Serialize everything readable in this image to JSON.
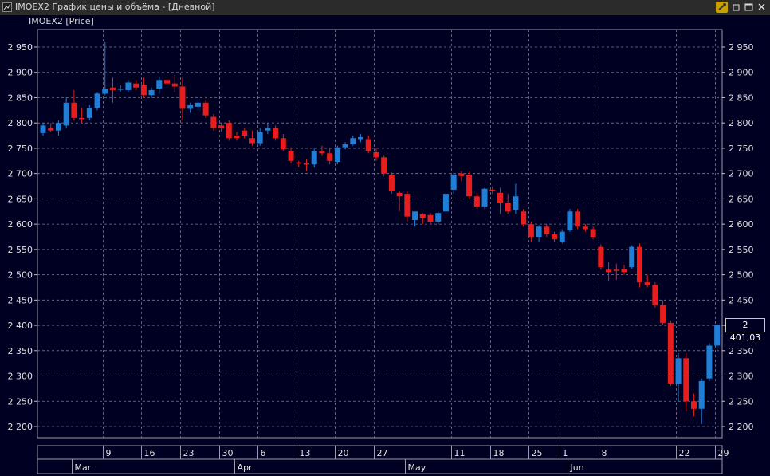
{
  "window": {
    "title": "IMOEX2 График цены и объёма - [Дневной]",
    "buttons": [
      "pin",
      "restore",
      "close"
    ]
  },
  "legend": {
    "label": "IMOEX2 [Price]"
  },
  "last_value_label": "2 401,03",
  "colors": {
    "background": "#000022",
    "up": "#1f7fd6",
    "down": "#e81e1e",
    "grid": "#7a7a90"
  },
  "chart_data": {
    "type": "candlestick",
    "title": "",
    "y_axis": {
      "ylim": [
        2180,
        2970
      ],
      "ticks": [
        2950,
        2900,
        2850,
        2800,
        2750,
        2700,
        2650,
        2600,
        2550,
        2500,
        2450,
        2400,
        2350,
        2300,
        2250,
        2200
      ],
      "tick_labels": [
        "2 950",
        "2 900",
        "2 850",
        "2 800",
        "2 750",
        "2 700",
        "2 650",
        "2 600",
        "2 550",
        "2 500",
        "2 450",
        "2 400",
        "2 350",
        "2 300",
        "2 250",
        "2 200"
      ],
      "both_sides": true
    },
    "x_axis": {
      "day_labels": [
        {
          "label": "9",
          "index": 8
        },
        {
          "label": "16",
          "index": 13
        },
        {
          "label": "23",
          "index": 18
        },
        {
          "label": "30",
          "index": 23
        },
        {
          "label": "6",
          "index": 28
        },
        {
          "label": "13",
          "index": 33
        },
        {
          "label": "20",
          "index": 38
        },
        {
          "label": "27",
          "index": 43
        },
        {
          "label": "11",
          "index": 53
        },
        {
          "label": "18",
          "index": 58
        },
        {
          "label": "25",
          "index": 63
        },
        {
          "label": "1",
          "index": 67
        },
        {
          "label": "8",
          "index": 72
        },
        {
          "label": "22",
          "index": 82
        },
        {
          "label": "29",
          "index": 87
        }
      ],
      "month_labels": [
        {
          "label": "Mar",
          "index": 4
        },
        {
          "label": "Apr",
          "index": 25
        },
        {
          "label": "May",
          "index": 47
        },
        {
          "label": "Jun",
          "index": 68
        }
      ]
    },
    "grid": true,
    "candles": [
      {
        "o": 2780,
        "h": 2800,
        "l": 2775,
        "c": 2795
      },
      {
        "o": 2790,
        "h": 2800,
        "l": 2782,
        "c": 2785
      },
      {
        "o": 2785,
        "h": 2805,
        "l": 2775,
        "c": 2800
      },
      {
        "o": 2795,
        "h": 2850,
        "l": 2790,
        "c": 2840
      },
      {
        "o": 2840,
        "h": 2865,
        "l": 2805,
        "c": 2810
      },
      {
        "o": 2810,
        "h": 2830,
        "l": 2800,
        "c": 2808
      },
      {
        "o": 2810,
        "h": 2835,
        "l": 2805,
        "c": 2830
      },
      {
        "o": 2830,
        "h": 2860,
        "l": 2825,
        "c": 2858
      },
      {
        "o": 2858,
        "h": 2960,
        "l": 2855,
        "c": 2868
      },
      {
        "o": 2870,
        "h": 2890,
        "l": 2840,
        "c": 2865
      },
      {
        "o": 2866,
        "h": 2875,
        "l": 2862,
        "c": 2868
      },
      {
        "o": 2865,
        "h": 2885,
        "l": 2860,
        "c": 2880
      },
      {
        "o": 2878,
        "h": 2885,
        "l": 2865,
        "c": 2870
      },
      {
        "o": 2875,
        "h": 2890,
        "l": 2850,
        "c": 2855
      },
      {
        "o": 2855,
        "h": 2870,
        "l": 2850,
        "c": 2865
      },
      {
        "o": 2868,
        "h": 2892,
        "l": 2858,
        "c": 2885
      },
      {
        "o": 2885,
        "h": 2895,
        "l": 2870,
        "c": 2878
      },
      {
        "o": 2878,
        "h": 2895,
        "l": 2860,
        "c": 2872
      },
      {
        "o": 2872,
        "h": 2890,
        "l": 2805,
        "c": 2828
      },
      {
        "o": 2828,
        "h": 2840,
        "l": 2820,
        "c": 2835
      },
      {
        "o": 2832,
        "h": 2845,
        "l": 2825,
        "c": 2840
      },
      {
        "o": 2840,
        "h": 2845,
        "l": 2810,
        "c": 2815
      },
      {
        "o": 2812,
        "h": 2818,
        "l": 2785,
        "c": 2790
      },
      {
        "o": 2795,
        "h": 2800,
        "l": 2783,
        "c": 2790
      },
      {
        "o": 2800,
        "h": 2805,
        "l": 2765,
        "c": 2770
      },
      {
        "o": 2775,
        "h": 2782,
        "l": 2765,
        "c": 2770
      },
      {
        "o": 2785,
        "h": 2790,
        "l": 2770,
        "c": 2775
      },
      {
        "o": 2770,
        "h": 2785,
        "l": 2755,
        "c": 2760
      },
      {
        "o": 2760,
        "h": 2790,
        "l": 2755,
        "c": 2782
      },
      {
        "o": 2785,
        "h": 2800,
        "l": 2778,
        "c": 2790
      },
      {
        "o": 2790,
        "h": 2795,
        "l": 2765,
        "c": 2770
      },
      {
        "o": 2770,
        "h": 2778,
        "l": 2745,
        "c": 2748
      },
      {
        "o": 2745,
        "h": 2752,
        "l": 2720,
        "c": 2725
      },
      {
        "o": 2722,
        "h": 2725,
        "l": 2712,
        "c": 2720
      },
      {
        "o": 2720,
        "h": 2728,
        "l": 2705,
        "c": 2718
      },
      {
        "o": 2718,
        "h": 2750,
        "l": 2712,
        "c": 2745
      },
      {
        "o": 2745,
        "h": 2755,
        "l": 2735,
        "c": 2740
      },
      {
        "o": 2740,
        "h": 2750,
        "l": 2718,
        "c": 2725
      },
      {
        "o": 2723,
        "h": 2755,
        "l": 2718,
        "c": 2752
      },
      {
        "o": 2752,
        "h": 2762,
        "l": 2748,
        "c": 2758
      },
      {
        "o": 2758,
        "h": 2775,
        "l": 2755,
        "c": 2770
      },
      {
        "o": 2768,
        "h": 2778,
        "l": 2762,
        "c": 2772
      },
      {
        "o": 2768,
        "h": 2775,
        "l": 2740,
        "c": 2745
      },
      {
        "o": 2742,
        "h": 2750,
        "l": 2725,
        "c": 2732
      },
      {
        "o": 2732,
        "h": 2735,
        "l": 2695,
        "c": 2700
      },
      {
        "o": 2698,
        "h": 2702,
        "l": 2660,
        "c": 2665
      },
      {
        "o": 2662,
        "h": 2665,
        "l": 2625,
        "c": 2655
      },
      {
        "o": 2660,
        "h": 2665,
        "l": 2605,
        "c": 2615
      },
      {
        "o": 2608,
        "h": 2615,
        "l": 2595,
        "c": 2625
      },
      {
        "o": 2620,
        "h": 2622,
        "l": 2600,
        "c": 2612
      },
      {
        "o": 2618,
        "h": 2622,
        "l": 2600,
        "c": 2605
      },
      {
        "o": 2605,
        "h": 2625,
        "l": 2600,
        "c": 2622
      },
      {
        "o": 2625,
        "h": 2665,
        "l": 2620,
        "c": 2660
      },
      {
        "o": 2668,
        "h": 2702,
        "l": 2660,
        "c": 2698
      },
      {
        "o": 2700,
        "h": 2705,
        "l": 2685,
        "c": 2695
      },
      {
        "o": 2698,
        "h": 2705,
        "l": 2650,
        "c": 2655
      },
      {
        "o": 2655,
        "h": 2662,
        "l": 2630,
        "c": 2635
      },
      {
        "o": 2635,
        "h": 2672,
        "l": 2630,
        "c": 2670
      },
      {
        "o": 2668,
        "h": 2675,
        "l": 2660,
        "c": 2665
      },
      {
        "o": 2662,
        "h": 2672,
        "l": 2620,
        "c": 2642
      },
      {
        "o": 2642,
        "h": 2660,
        "l": 2620,
        "c": 2625
      },
      {
        "o": 2628,
        "h": 2680,
        "l": 2620,
        "c": 2655
      },
      {
        "o": 2625,
        "h": 2630,
        "l": 2595,
        "c": 2600
      },
      {
        "o": 2600,
        "h": 2605,
        "l": 2565,
        "c": 2575
      },
      {
        "o": 2575,
        "h": 2598,
        "l": 2565,
        "c": 2595
      },
      {
        "o": 2595,
        "h": 2600,
        "l": 2575,
        "c": 2580
      },
      {
        "o": 2580,
        "h": 2585,
        "l": 2565,
        "c": 2570
      },
      {
        "o": 2565,
        "h": 2590,
        "l": 2562,
        "c": 2585
      },
      {
        "o": 2588,
        "h": 2630,
        "l": 2585,
        "c": 2625
      },
      {
        "o": 2625,
        "h": 2630,
        "l": 2590,
        "c": 2595
      },
      {
        "o": 2595,
        "h": 2600,
        "l": 2585,
        "c": 2590
      },
      {
        "o": 2590,
        "h": 2595,
        "l": 2570,
        "c": 2575
      },
      {
        "o": 2555,
        "h": 2560,
        "l": 2510,
        "c": 2515
      },
      {
        "o": 2510,
        "h": 2525,
        "l": 2488,
        "c": 2505
      },
      {
        "o": 2510,
        "h": 2522,
        "l": 2490,
        "c": 2508
      },
      {
        "o": 2512,
        "h": 2520,
        "l": 2500,
        "c": 2505
      },
      {
        "o": 2515,
        "h": 2558,
        "l": 2512,
        "c": 2555
      },
      {
        "o": 2555,
        "h": 2562,
        "l": 2475,
        "c": 2485
      },
      {
        "o": 2485,
        "h": 2500,
        "l": 2475,
        "c": 2480
      },
      {
        "o": 2480,
        "h": 2485,
        "l": 2435,
        "c": 2440
      },
      {
        "o": 2440,
        "h": 2450,
        "l": 2400,
        "c": 2405
      },
      {
        "o": 2405,
        "h": 2410,
        "l": 2280,
        "c": 2285
      },
      {
        "o": 2285,
        "h": 2345,
        "l": 2250,
        "c": 2335
      },
      {
        "o": 2335,
        "h": 2345,
        "l": 2230,
        "c": 2250
      },
      {
        "o": 2250,
        "h": 2265,
        "l": 2220,
        "c": 2235
      },
      {
        "o": 2235,
        "h": 2295,
        "l": 2205,
        "c": 2290
      },
      {
        "o": 2295,
        "h": 2365,
        "l": 2290,
        "c": 2360
      },
      {
        "o": 2360,
        "h": 2405,
        "l": 2350,
        "c": 2401
      }
    ]
  }
}
